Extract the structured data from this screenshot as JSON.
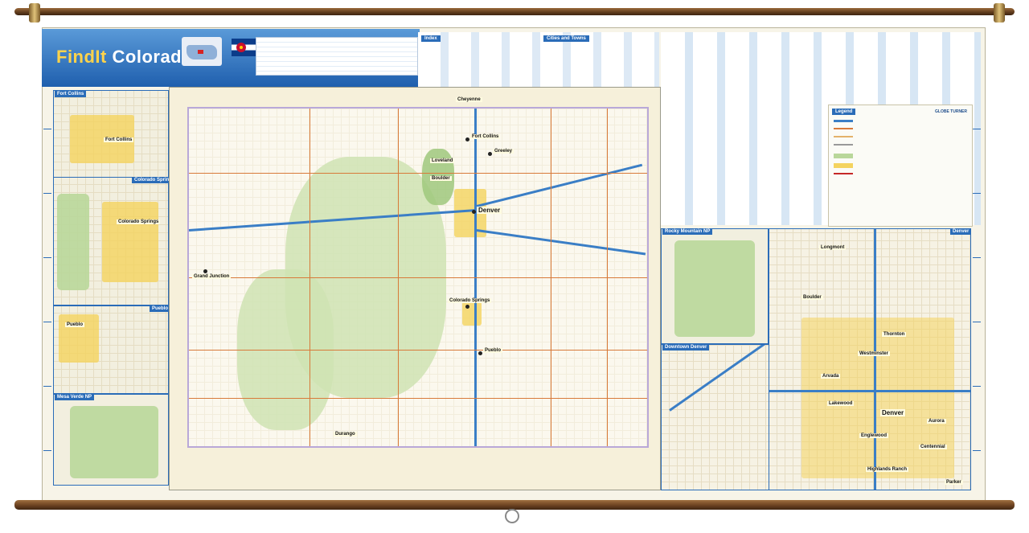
{
  "header": {
    "brand": "FindIt",
    "state": "Colorado"
  },
  "index": {
    "title": "Index",
    "cities_title": "Cities and Towns"
  },
  "legend": {
    "title": "Legend",
    "publisher": "GLOBE TURNER"
  },
  "insets": {
    "fort_collins": "Fort Collins",
    "colorado_springs": "Colorado Springs",
    "pueblo": "Pueblo",
    "mesa_verde": "Mesa Verde NP",
    "rocky_mountain": "Rocky Mountain NP",
    "downtown_denver": "Downtown Denver",
    "denver": "Denver"
  },
  "main_map_cities": {
    "fort_collins": "Fort Collins",
    "greeley": "Greeley",
    "loveland": "Loveland",
    "boulder": "Boulder",
    "denver": "Denver",
    "colorado_springs": "Colorado Springs",
    "pueblo": "Pueblo",
    "grand_junction": "Grand Junction",
    "cheyenne": "Cheyenne",
    "durango": "Durango"
  },
  "inset_cities": {
    "fort_collins": "Fort Collins",
    "colorado_springs": "Colorado Springs",
    "pueblo": "Pueblo",
    "boulder": "Boulder",
    "longmont": "Longmont",
    "arvada": "Arvada",
    "westminster": "Westminster",
    "thornton": "Thornton",
    "lakewood": "Lakewood",
    "denver": "Denver",
    "aurora": "Aurora",
    "centennial": "Centennial",
    "highlands_ranch": "Highlands Ranch",
    "parker": "Parker",
    "englewood": "Englewood"
  },
  "colors": {
    "frame_blue": "#2a6cb8",
    "title_gold": "#ffd34a",
    "urban": "#f4d35e",
    "park": "#b9d79a",
    "road": "#d87a3a",
    "interstate": "#3a7ec6",
    "rod": "#6b4221"
  },
  "icons": {
    "flag": "colorado-flag-icon",
    "locator": "us-locator-map-icon",
    "hook": "hanging-hook-icon"
  }
}
